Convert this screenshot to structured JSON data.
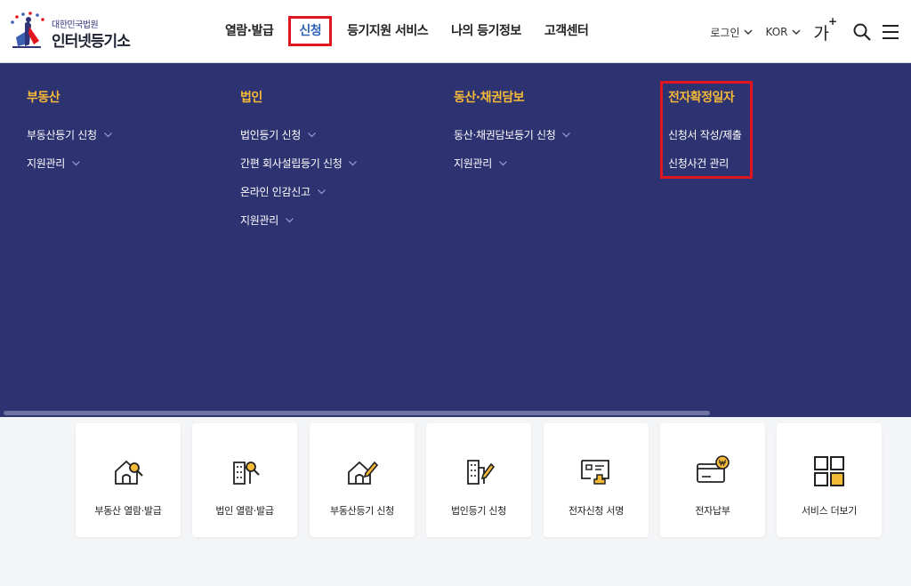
{
  "header": {
    "logo_sub": "대한민국법원",
    "logo_main": "인터넷등기소",
    "nav": [
      {
        "label": "열람·발급"
      },
      {
        "label": "신청"
      },
      {
        "label": "등기지원 서비스"
      },
      {
        "label": "나의 등기정보"
      },
      {
        "label": "고객센터"
      }
    ],
    "util": {
      "login": "로그인",
      "lang": "KOR",
      "fontsize": "가",
      "fontsize_plus": "+"
    }
  },
  "menu": {
    "columns": [
      {
        "title": "부동산",
        "items": [
          "부동산등기 신청",
          "지원관리"
        ]
      },
      {
        "title": "법인",
        "items": [
          "법인등기 신청",
          "간편 회사설립등기 신청",
          "온라인 인감신고",
          "지원관리"
        ]
      },
      {
        "title": "동산·채권담보",
        "items": [
          "동산·채권담보등기 신청",
          "지원관리"
        ]
      },
      {
        "title": "전자확정일자",
        "items": [
          "신청서 작성/제출",
          "신청사건 관리"
        ]
      }
    ]
  },
  "cards": [
    {
      "label": "부동산 열람·발급",
      "icon": "house-search-icon"
    },
    {
      "label": "법인 열람·발급",
      "icon": "building-search-icon"
    },
    {
      "label": "부동산등기 신청",
      "icon": "house-pen-icon"
    },
    {
      "label": "법인등기 신청",
      "icon": "building-pen-icon"
    },
    {
      "label": "전자신청 서명",
      "icon": "document-stamp-icon"
    },
    {
      "label": "전자납부",
      "icon": "card-won-icon"
    },
    {
      "label": "서비스 더보기",
      "icon": "grid-icon"
    }
  ],
  "colors": {
    "menu_bg": "#2d3271",
    "menu_title": "#f5b938",
    "accent_blue": "#2f63b8",
    "highlight_red": "#e0151e",
    "icon_yellow": "#f5b938"
  }
}
